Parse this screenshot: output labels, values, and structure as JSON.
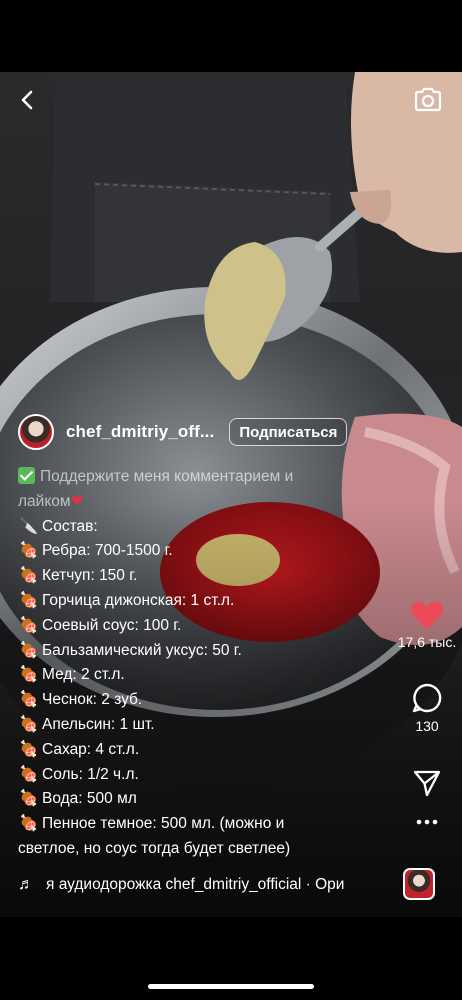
{
  "author": {
    "username": "chef_dmitriy_off...",
    "follow_label": "Подписаться"
  },
  "caption": {
    "intro": "Поддержите меня комментарием и лайком",
    "lines": [
      "Состав:",
      "Ребра: 700-1500 г.",
      "Кетчуп: 150 г.",
      "Горчица дижонская: 1 ст.л.",
      "Соевый соус: 100 г.",
      "Бальзамический уксус: 50 г.",
      "Мед: 2 ст.л.",
      "Чеснок: 2 зуб.",
      "Апельсин: 1 шт.",
      "Сахар: 4 ст.л.",
      "Соль: 1/2 ч.л.",
      "Вода: 500 мл",
      "Пенное темное: 500 мл. (можно и светлое, но соус тогда будет светлее)"
    ]
  },
  "actions": {
    "likes": "17,6 тыс.",
    "comments": "130"
  },
  "audio": {
    "text": "я аудиодорожка chef_dmitriy_official · Ори"
  },
  "icons": {
    "back": "chevron-left-icon",
    "camera": "camera-icon",
    "like": "heart-icon",
    "comment": "comment-icon",
    "share": "send-icon",
    "more": "more-icon",
    "music": "music-note-icon",
    "knife": "knife-icon",
    "meat": "meat-icon"
  },
  "colors": {
    "like_active": "#ed4956",
    "check_green": "#5cb85c"
  }
}
